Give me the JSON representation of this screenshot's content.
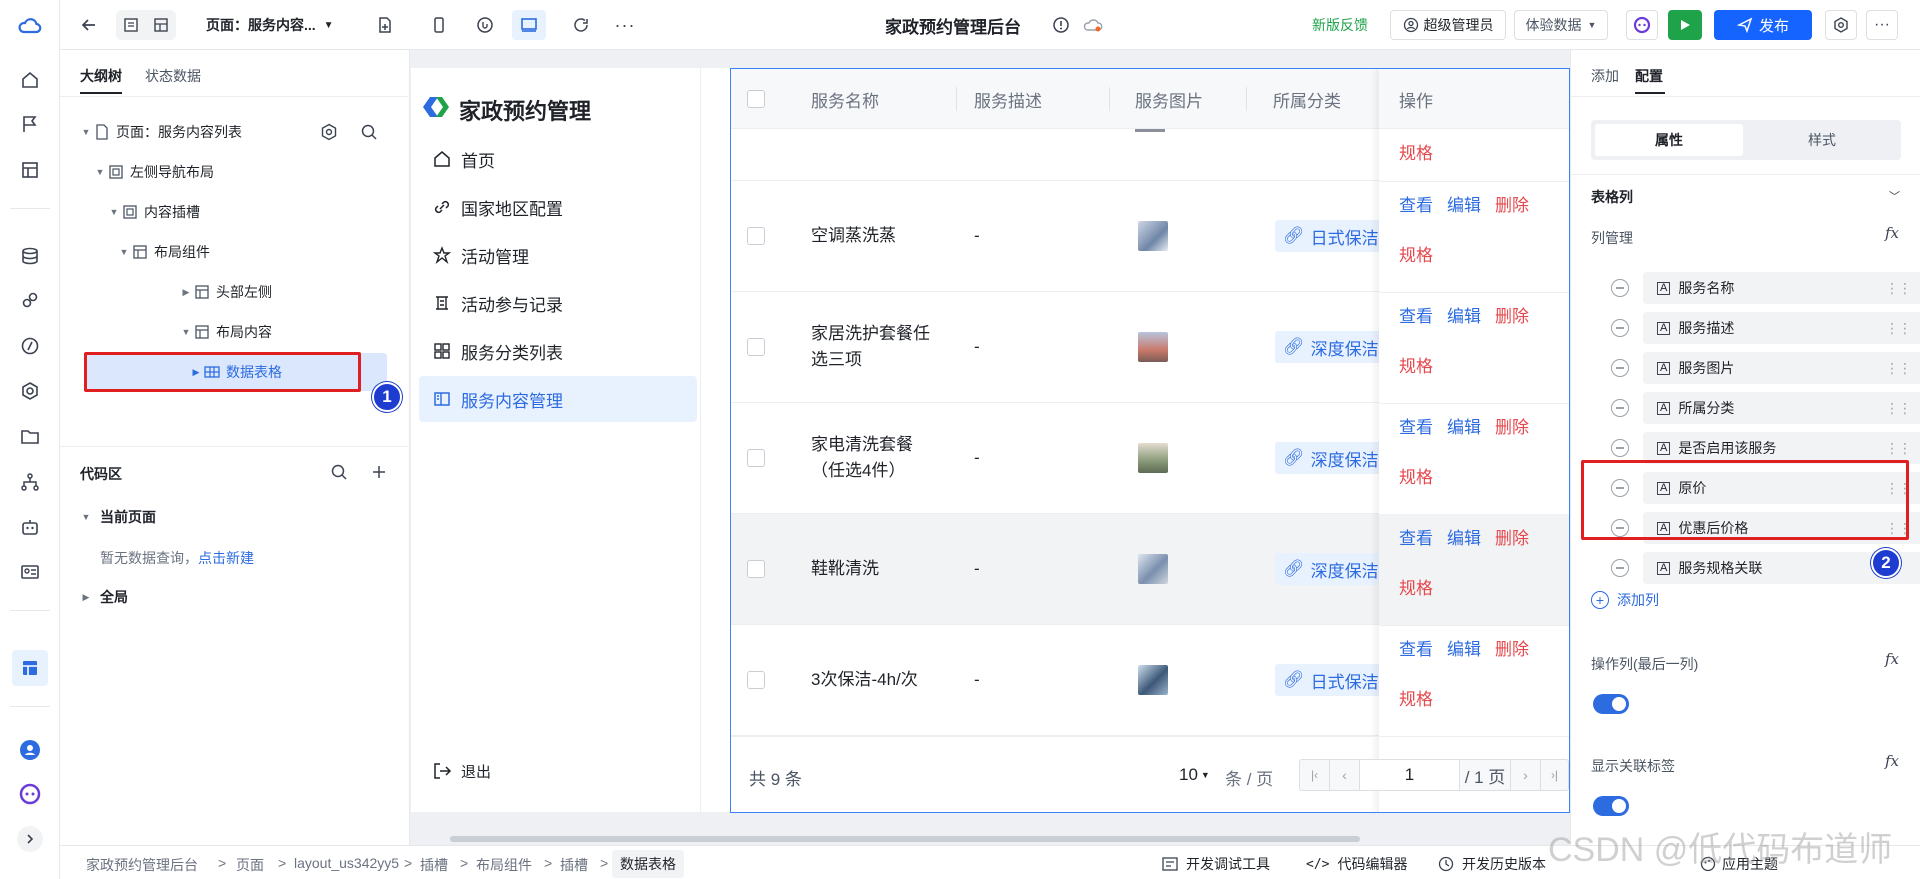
{
  "topbar": {
    "page_label": "页面：服务内容...",
    "title": "家政预约管理后台",
    "feedback": "新版反馈",
    "admin": "超级管理员",
    "dataset": "体验数据",
    "publish": "发布"
  },
  "outline": {
    "tabs": [
      "大纲树",
      "状态数据"
    ],
    "tree": [
      {
        "label": "页面：服务内容列表"
      },
      {
        "label": "左侧导航布局"
      },
      {
        "label": "内容插槽"
      },
      {
        "label": "布局组件"
      },
      {
        "label": "头部左侧"
      },
      {
        "label": "布局内容"
      },
      {
        "label": "数据表格"
      }
    ],
    "code_title": "代码区",
    "current_page": "当前页面",
    "empty_text": "暂无数据查询，",
    "create_link": "点击新建",
    "global": "全局"
  },
  "app": {
    "brand": "家政预约管理",
    "nav": [
      "首页",
      "国家地区配置",
      "活动管理",
      "活动参与记录",
      "服务分类列表",
      "服务内容管理"
    ],
    "logout": "退出"
  },
  "table": {
    "headers": [
      "服务名称",
      "服务描述",
      "服务图片",
      "所属分类",
      "操作"
    ],
    "top_spec": "规格",
    "rows": [
      {
        "name": "空调蒸洗蒸",
        "desc": "-",
        "category": "日式保洁"
      },
      {
        "name": "家居洗护套餐任\n选三项",
        "desc": "-",
        "category": "深度保洁"
      },
      {
        "name": "家电清洗套餐\n（任选4件）",
        "desc": "-",
        "category": "深度保洁"
      },
      {
        "name": "鞋靴清洗",
        "desc": "-",
        "category": "深度保洁"
      },
      {
        "name": "3次保洁-4h/次",
        "desc": "-",
        "category": "日式保洁"
      }
    ],
    "actions": {
      "view": "查看",
      "edit": "编辑",
      "delete": "删除",
      "spec": "规格"
    },
    "total": "共 9 条",
    "page_size": "10",
    "per_page": "条 / 页",
    "page_input": "1",
    "page_total": "/ 1 页"
  },
  "right": {
    "tabs": [
      "添加",
      "配置"
    ],
    "seg": [
      "属性",
      "样式"
    ],
    "section": "表格列",
    "col_manage": "列管理",
    "columns": [
      "服务名称",
      "服务描述",
      "服务图片",
      "所属分类",
      "是否启用该服务",
      "原价",
      "优惠后价格",
      "服务规格关联"
    ],
    "add_col": "添加列",
    "op_col": "操作列(最后一列)",
    "show_tag": "显示关联标签",
    "fx": "fx"
  },
  "status": {
    "crumbs": [
      "家政预约管理后台",
      "页面",
      "layout_us342yy5",
      "插槽",
      "布局组件",
      "插槽",
      "数据表格"
    ],
    "tools": [
      "开发调试工具",
      "代码编辑器",
      "开发历史版本"
    ],
    "theme": "应用主题",
    "watermark": "CSDN @低代码布道师"
  },
  "annotations": [
    "1",
    "2"
  ],
  "colors": {
    "accent": "#2c6be0",
    "publish": "#1664ff",
    "run": "#1fa34a",
    "danger": "#e5484d",
    "annot": "#e02020"
  }
}
